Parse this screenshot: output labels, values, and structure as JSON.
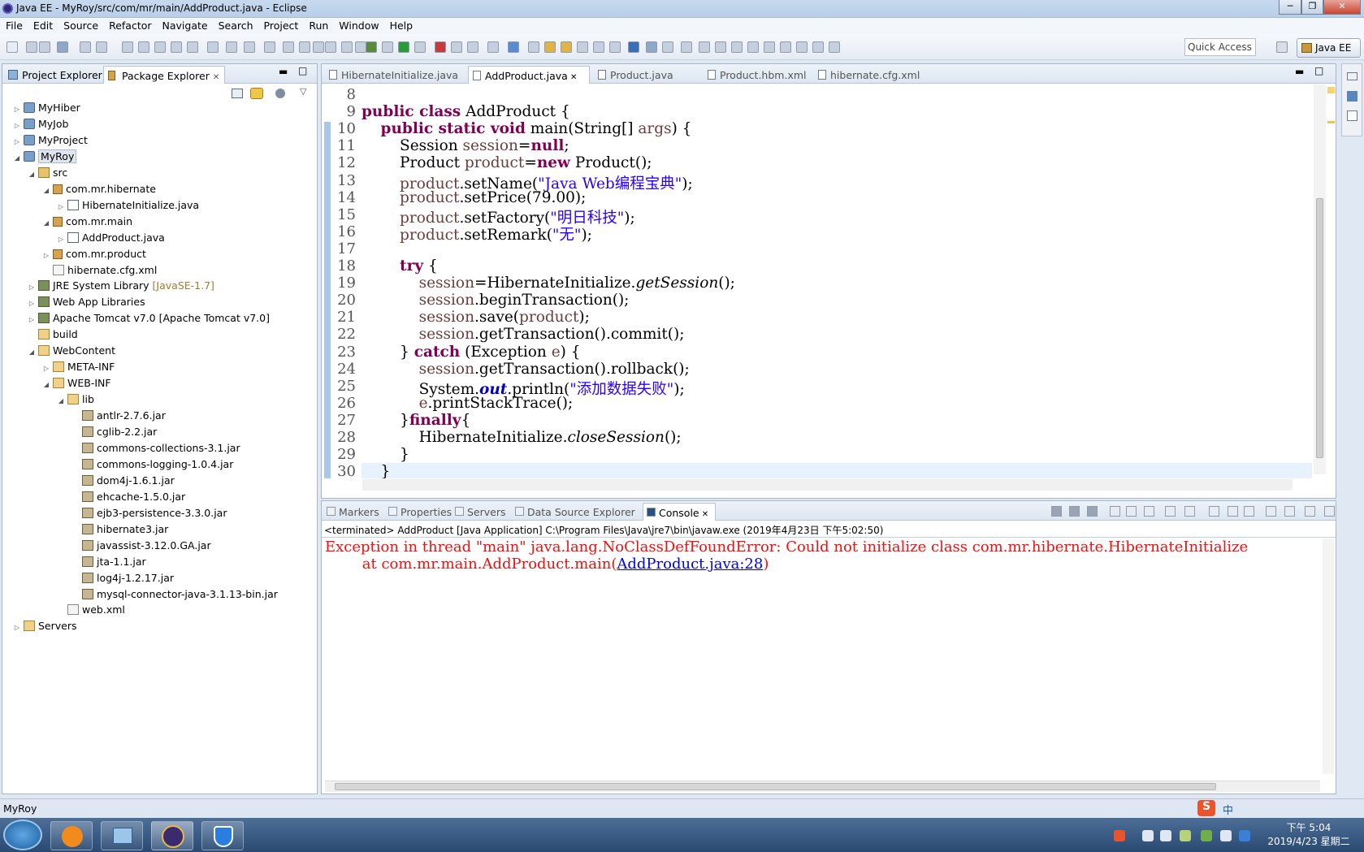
{
  "window": {
    "title": "Java EE - MyRoy/src/com/mr/main/AddProduct.java - Eclipse"
  },
  "menu": [
    "File",
    "Edit",
    "Source",
    "Refactor",
    "Navigate",
    "Search",
    "Project",
    "Run",
    "Window",
    "Help"
  ],
  "toolbar": {
    "quick_access": "Quick Access",
    "perspective": "Java EE"
  },
  "left_tabs": [
    {
      "label": "Project Explorer"
    },
    {
      "label": "Package Explorer",
      "active": true
    }
  ],
  "tree": [
    {
      "label": "MyHiber",
      "icon": "project-icon",
      "indent": 0,
      "twisty": "▷"
    },
    {
      "label": "MyJob",
      "icon": "project-icon",
      "indent": 0,
      "twisty": "▷"
    },
    {
      "label": "MyProject",
      "icon": "project-icon",
      "indent": 0,
      "twisty": "▷"
    },
    {
      "label": "MyRoy",
      "icon": "project-icon",
      "indent": 0,
      "twisty": "◢",
      "selected": true
    },
    {
      "label": "src",
      "icon": "source-folder-icon",
      "indent": 1,
      "twisty": "◢"
    },
    {
      "label": "com.mr.hibernate",
      "icon": "package-icon",
      "indent": 2,
      "twisty": "◢"
    },
    {
      "label": "HibernateInitialize.java",
      "icon": "java-file-icon",
      "indent": 3,
      "twisty": "▷"
    },
    {
      "label": "com.mr.main",
      "icon": "package-icon",
      "indent": 2,
      "twisty": "◢"
    },
    {
      "label": "AddProduct.java",
      "icon": "java-file-icon",
      "indent": 3,
      "twisty": "▷"
    },
    {
      "label": "com.mr.product",
      "icon": "package-icon",
      "indent": 2,
      "twisty": "▷"
    },
    {
      "label": "hibernate.cfg.xml",
      "icon": "xml-file-icon",
      "indent": 2,
      "twisty": ""
    },
    {
      "label": "JRE System Library",
      "deco": "[JavaSE-1.7]",
      "icon": "library-icon",
      "indent": 1,
      "twisty": "▷"
    },
    {
      "label": "Web App Libraries",
      "icon": "library-icon",
      "indent": 1,
      "twisty": "▷"
    },
    {
      "label": "Apache Tomcat v7.0 [Apache Tomcat v7.0]",
      "icon": "library-icon",
      "indent": 1,
      "twisty": "▷"
    },
    {
      "label": "build",
      "icon": "folder-icon",
      "indent": 1,
      "twisty": ""
    },
    {
      "label": "WebContent",
      "icon": "folder-icon",
      "indent": 1,
      "twisty": "◢"
    },
    {
      "label": "META-INF",
      "icon": "folder-icon",
      "indent": 2,
      "twisty": "▷"
    },
    {
      "label": "WEB-INF",
      "icon": "folder-icon",
      "indent": 2,
      "twisty": "◢"
    },
    {
      "label": "lib",
      "icon": "folder-icon",
      "indent": 3,
      "twisty": "◢"
    },
    {
      "label": "antlr-2.7.6.jar",
      "icon": "jar-icon",
      "indent": 4,
      "twisty": ""
    },
    {
      "label": "cglib-2.2.jar",
      "icon": "jar-icon",
      "indent": 4,
      "twisty": ""
    },
    {
      "label": "commons-collections-3.1.jar",
      "icon": "jar-icon",
      "indent": 4,
      "twisty": ""
    },
    {
      "label": "commons-logging-1.0.4.jar",
      "icon": "jar-icon",
      "indent": 4,
      "twisty": ""
    },
    {
      "label": "dom4j-1.6.1.jar",
      "icon": "jar-icon",
      "indent": 4,
      "twisty": ""
    },
    {
      "label": "ehcache-1.5.0.jar",
      "icon": "jar-icon",
      "indent": 4,
      "twisty": ""
    },
    {
      "label": "ejb3-persistence-3.3.0.jar",
      "icon": "jar-icon",
      "indent": 4,
      "twisty": ""
    },
    {
      "label": "hibernate3.jar",
      "icon": "jar-icon",
      "indent": 4,
      "twisty": ""
    },
    {
      "label": "javassist-3.12.0.GA.jar",
      "icon": "jar-icon",
      "indent": 4,
      "twisty": ""
    },
    {
      "label": "jta-1.1.jar",
      "icon": "jar-icon",
      "indent": 4,
      "twisty": ""
    },
    {
      "label": "log4j-1.2.17.jar",
      "icon": "jar-icon",
      "indent": 4,
      "twisty": ""
    },
    {
      "label": "mysql-connector-java-3.1.13-bin.jar",
      "icon": "jar-icon",
      "indent": 4,
      "twisty": ""
    },
    {
      "label": "web.xml",
      "icon": "xml-file-icon",
      "indent": 3,
      "twisty": ""
    },
    {
      "label": "Servers",
      "icon": "folder-icon",
      "indent": 0,
      "twisty": "▷"
    }
  ],
  "editor_tabs": [
    {
      "label": "HibernateInitialize.java"
    },
    {
      "label": "AddProduct.java",
      "active": true
    },
    {
      "label": "Product.java"
    },
    {
      "label": "Product.hbm.xml"
    },
    {
      "label": "hibernate.cfg.xml"
    }
  ],
  "code": [
    {
      "n": "8",
      "html": ""
    },
    {
      "n": "9",
      "html": "<span class='kw'>public class</span> AddProduct {"
    },
    {
      "n": "10",
      "html": "    <span class='kw'>public static void</span> main(String[] <span class='var'>args</span>) {"
    },
    {
      "n": "11",
      "html": "        Session <span class='var'>session</span>=<span class='kw'>null</span>;"
    },
    {
      "n": "12",
      "html": "        Product <span class='var'>product</span>=<span class='kw'>new</span> Product();"
    },
    {
      "n": "13",
      "html": "        <span class='var'>product</span>.setName(<span class='str'>\"Java Web编程宝典\"</span>);"
    },
    {
      "n": "14",
      "html": "        <span class='var'>product</span>.setPrice(79.00);"
    },
    {
      "n": "15",
      "html": "        <span class='var'>product</span>.setFactory(<span class='str'>\"明日科技\"</span>);"
    },
    {
      "n": "16",
      "html": "        <span class='var'>product</span>.setRemark(<span class='str'>\"无\"</span>);"
    },
    {
      "n": "17",
      "html": ""
    },
    {
      "n": "18",
      "html": "        <span class='kw'>try</span> {"
    },
    {
      "n": "19",
      "html": "            <span class='var'>session</span>=HibernateInitialize.<span class='it'>getSession</span>();"
    },
    {
      "n": "20",
      "html": "            <span class='var'>session</span>.beginTransaction();"
    },
    {
      "n": "21",
      "html": "            <span class='var'>session</span>.save(<span class='var'>product</span>);"
    },
    {
      "n": "22",
      "html": "            <span class='var'>session</span>.getTransaction().commit();"
    },
    {
      "n": "23",
      "html": "        } <span class='kw'>catch</span> (Exception <span class='var'>e</span>) {"
    },
    {
      "n": "24",
      "html": "            <span class='var'>session</span>.getTransaction().rollback();"
    },
    {
      "n": "25",
      "html": "            System.<span class='sfld'>out</span>.println(<span class='str'>\"添加数据失败\"</span>);"
    },
    {
      "n": "26",
      "html": "            <span class='var'>e</span>.printStackTrace();"
    },
    {
      "n": "27",
      "html": "        }<span class='kw'>finally</span>{"
    },
    {
      "n": "28",
      "html": "            HibernateInitialize.<span class='it'>closeSession</span>();"
    },
    {
      "n": "29",
      "html": "        }"
    },
    {
      "n": "30",
      "html": "    }"
    }
  ],
  "console_tabs": [
    {
      "label": "Markers"
    },
    {
      "label": "Properties"
    },
    {
      "label": "Servers"
    },
    {
      "label": "Data Source Explorer"
    },
    {
      "label": "Console",
      "active": true
    }
  ],
  "console": {
    "terminated": "<terminated> AddProduct [Java Application] C:\\Program Files\\Java\\jre7\\bin\\javaw.exe (2019年4月23日 下午5:02:50)",
    "line1": "Exception in thread \"main\" java.lang.NoClassDefFoundError: Could not initialize class com.mr.hibernate.HibernateInitialize",
    "line2_prefix": "        at com.mr.main.AddProduct.main(",
    "line2_link": "AddProduct.java:28",
    "line2_suffix": ")"
  },
  "status": {
    "text": "MyRoy"
  },
  "clock": {
    "time": "下午 5:04",
    "date": "2019/4/23 星期二"
  },
  "ime": {
    "label": "中"
  },
  "colors": {
    "keyword": "#7f0055",
    "string": "#2a00ff",
    "error": "#e11",
    "accent": "#a8c8ec"
  }
}
